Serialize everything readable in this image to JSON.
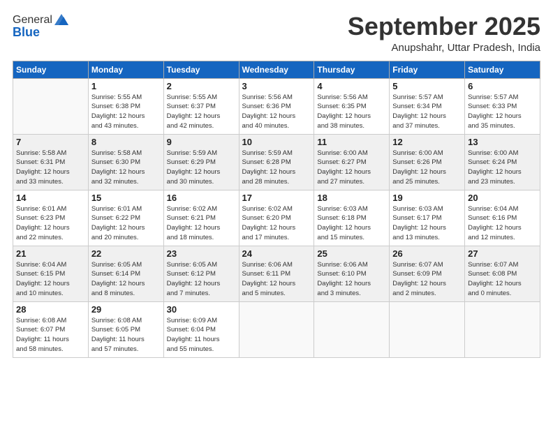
{
  "logo": {
    "general": "General",
    "blue": "Blue"
  },
  "title": "September 2025",
  "location": "Anupshahr, Uttar Pradesh, India",
  "days_header": [
    "Sunday",
    "Monday",
    "Tuesday",
    "Wednesday",
    "Thursday",
    "Friday",
    "Saturday"
  ],
  "weeks": [
    [
      {
        "day": "",
        "info": ""
      },
      {
        "day": "1",
        "info": "Sunrise: 5:55 AM\nSunset: 6:38 PM\nDaylight: 12 hours\nand 43 minutes."
      },
      {
        "day": "2",
        "info": "Sunrise: 5:55 AM\nSunset: 6:37 PM\nDaylight: 12 hours\nand 42 minutes."
      },
      {
        "day": "3",
        "info": "Sunrise: 5:56 AM\nSunset: 6:36 PM\nDaylight: 12 hours\nand 40 minutes."
      },
      {
        "day": "4",
        "info": "Sunrise: 5:56 AM\nSunset: 6:35 PM\nDaylight: 12 hours\nand 38 minutes."
      },
      {
        "day": "5",
        "info": "Sunrise: 5:57 AM\nSunset: 6:34 PM\nDaylight: 12 hours\nand 37 minutes."
      },
      {
        "day": "6",
        "info": "Sunrise: 5:57 AM\nSunset: 6:33 PM\nDaylight: 12 hours\nand 35 minutes."
      }
    ],
    [
      {
        "day": "7",
        "info": "Sunrise: 5:58 AM\nSunset: 6:31 PM\nDaylight: 12 hours\nand 33 minutes."
      },
      {
        "day": "8",
        "info": "Sunrise: 5:58 AM\nSunset: 6:30 PM\nDaylight: 12 hours\nand 32 minutes."
      },
      {
        "day": "9",
        "info": "Sunrise: 5:59 AM\nSunset: 6:29 PM\nDaylight: 12 hours\nand 30 minutes."
      },
      {
        "day": "10",
        "info": "Sunrise: 5:59 AM\nSunset: 6:28 PM\nDaylight: 12 hours\nand 28 minutes."
      },
      {
        "day": "11",
        "info": "Sunrise: 6:00 AM\nSunset: 6:27 PM\nDaylight: 12 hours\nand 27 minutes."
      },
      {
        "day": "12",
        "info": "Sunrise: 6:00 AM\nSunset: 6:26 PM\nDaylight: 12 hours\nand 25 minutes."
      },
      {
        "day": "13",
        "info": "Sunrise: 6:00 AM\nSunset: 6:24 PM\nDaylight: 12 hours\nand 23 minutes."
      }
    ],
    [
      {
        "day": "14",
        "info": "Sunrise: 6:01 AM\nSunset: 6:23 PM\nDaylight: 12 hours\nand 22 minutes."
      },
      {
        "day": "15",
        "info": "Sunrise: 6:01 AM\nSunset: 6:22 PM\nDaylight: 12 hours\nand 20 minutes."
      },
      {
        "day": "16",
        "info": "Sunrise: 6:02 AM\nSunset: 6:21 PM\nDaylight: 12 hours\nand 18 minutes."
      },
      {
        "day": "17",
        "info": "Sunrise: 6:02 AM\nSunset: 6:20 PM\nDaylight: 12 hours\nand 17 minutes."
      },
      {
        "day": "18",
        "info": "Sunrise: 6:03 AM\nSunset: 6:18 PM\nDaylight: 12 hours\nand 15 minutes."
      },
      {
        "day": "19",
        "info": "Sunrise: 6:03 AM\nSunset: 6:17 PM\nDaylight: 12 hours\nand 13 minutes."
      },
      {
        "day": "20",
        "info": "Sunrise: 6:04 AM\nSunset: 6:16 PM\nDaylight: 12 hours\nand 12 minutes."
      }
    ],
    [
      {
        "day": "21",
        "info": "Sunrise: 6:04 AM\nSunset: 6:15 PM\nDaylight: 12 hours\nand 10 minutes."
      },
      {
        "day": "22",
        "info": "Sunrise: 6:05 AM\nSunset: 6:14 PM\nDaylight: 12 hours\nand 8 minutes."
      },
      {
        "day": "23",
        "info": "Sunrise: 6:05 AM\nSunset: 6:12 PM\nDaylight: 12 hours\nand 7 minutes."
      },
      {
        "day": "24",
        "info": "Sunrise: 6:06 AM\nSunset: 6:11 PM\nDaylight: 12 hours\nand 5 minutes."
      },
      {
        "day": "25",
        "info": "Sunrise: 6:06 AM\nSunset: 6:10 PM\nDaylight: 12 hours\nand 3 minutes."
      },
      {
        "day": "26",
        "info": "Sunrise: 6:07 AM\nSunset: 6:09 PM\nDaylight: 12 hours\nand 2 minutes."
      },
      {
        "day": "27",
        "info": "Sunrise: 6:07 AM\nSunset: 6:08 PM\nDaylight: 12 hours\nand 0 minutes."
      }
    ],
    [
      {
        "day": "28",
        "info": "Sunrise: 6:08 AM\nSunset: 6:07 PM\nDaylight: 11 hours\nand 58 minutes."
      },
      {
        "day": "29",
        "info": "Sunrise: 6:08 AM\nSunset: 6:05 PM\nDaylight: 11 hours\nand 57 minutes."
      },
      {
        "day": "30",
        "info": "Sunrise: 6:09 AM\nSunset: 6:04 PM\nDaylight: 11 hours\nand 55 minutes."
      },
      {
        "day": "",
        "info": ""
      },
      {
        "day": "",
        "info": ""
      },
      {
        "day": "",
        "info": ""
      },
      {
        "day": "",
        "info": ""
      }
    ]
  ]
}
